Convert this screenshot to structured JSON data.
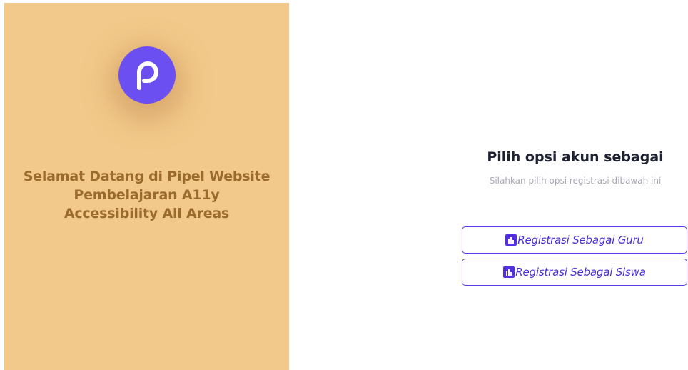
{
  "welcome": {
    "line1": "Selamat Datang di Pipel Website",
    "line2": "Pembelajaran A11y",
    "line3": "Accessibility All Areas"
  },
  "logo": {
    "icon": "pipel-logo-icon",
    "color": "#6b4ff0"
  },
  "options": {
    "title": "Pilih opsi akun sebagai",
    "subtitle": "Silahkan pilih opsi registrasi dibawah ini",
    "buttons": [
      {
        "label": "Registrasi Sebagai Guru",
        "icon": "chart-icon"
      },
      {
        "label": "Registrasi Sebagai Siswa",
        "icon": "chart-icon"
      }
    ]
  },
  "colors": {
    "panel_background": "#f2c98a",
    "welcome_text": "#9a6b2c",
    "accent": "#5230e0"
  }
}
